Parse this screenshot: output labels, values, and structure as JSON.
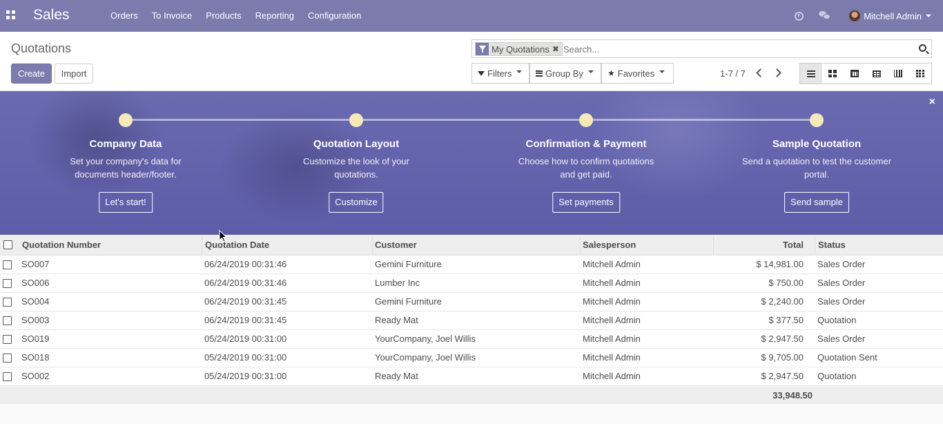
{
  "navbar": {
    "brand": "Sales",
    "menu": [
      "Orders",
      "To Invoice",
      "Products",
      "Reporting",
      "Configuration"
    ],
    "user": "Mitchell Admin",
    "icons": [
      "apps-icon",
      "clock-icon",
      "chat-icon"
    ]
  },
  "control": {
    "title": "Quotations",
    "create": "Create",
    "import": "Import",
    "facet": "My Quotations",
    "search_placeholder": "Search...",
    "filters": "Filters",
    "group_by": "Group By",
    "favorites": "Favorites",
    "pager": "1-7 / 7",
    "views": [
      "list-view",
      "kanban-view",
      "calendar-view",
      "pivot-view",
      "graph-view",
      "grid-view"
    ],
    "active_view": "list-view"
  },
  "banner": {
    "steps": [
      {
        "title": "Company Data",
        "desc": "Set your company's data for documents header/footer.",
        "button": "Let's start!"
      },
      {
        "title": "Quotation Layout",
        "desc": "Customize the look of your quotations.",
        "button": "Customize"
      },
      {
        "title": "Confirmation & Payment",
        "desc": "Choose how to confirm quotations and get paid.",
        "button": "Set payments"
      },
      {
        "title": "Sample Quotation",
        "desc": "Send a quotation to test the customer portal.",
        "button": "Send sample"
      }
    ],
    "close": "×"
  },
  "table": {
    "headers": {
      "number": "Quotation Number",
      "date": "Quotation Date",
      "customer": "Customer",
      "salesperson": "Salesperson",
      "total": "Total",
      "status": "Status"
    },
    "rows": [
      {
        "number": "SO007",
        "date": "06/24/2019 00:31:46",
        "customer": "Gemini Furniture",
        "salesperson": "Mitchell Admin",
        "total": "$ 14,981.00",
        "status": "Sales Order"
      },
      {
        "number": "SO006",
        "date": "06/24/2019 00:31:46",
        "customer": "Lumber Inc",
        "salesperson": "Mitchell Admin",
        "total": "$ 750.00",
        "status": "Sales Order"
      },
      {
        "number": "SO004",
        "date": "06/24/2019 00:31:45",
        "customer": "Gemini Furniture",
        "salesperson": "Mitchell Admin",
        "total": "$ 2,240.00",
        "status": "Sales Order"
      },
      {
        "number": "SO003",
        "date": "06/24/2019 00:31:45",
        "customer": "Ready Mat",
        "salesperson": "Mitchell Admin",
        "total": "$ 377.50",
        "status": "Quotation"
      },
      {
        "number": "SO019",
        "date": "05/24/2019 00:31:00",
        "customer": "YourCompany, Joel Willis",
        "salesperson": "Mitchell Admin",
        "total": "$ 2,947.50",
        "status": "Sales Order"
      },
      {
        "number": "SO018",
        "date": "05/24/2019 00:31:00",
        "customer": "YourCompany, Joel Willis",
        "salesperson": "Mitchell Admin",
        "total": "$ 9,705.00",
        "status": "Quotation Sent"
      },
      {
        "number": "SO002",
        "date": "05/24/2019 00:31:00",
        "customer": "Ready Mat",
        "salesperson": "Mitchell Admin",
        "total": "$ 2,947.50",
        "status": "Quotation"
      }
    ],
    "sum_total": "33,948.50"
  },
  "colors": {
    "brand": "#7c7bad",
    "banner": "#5d5ca8",
    "dot": "#f5e9b8"
  }
}
